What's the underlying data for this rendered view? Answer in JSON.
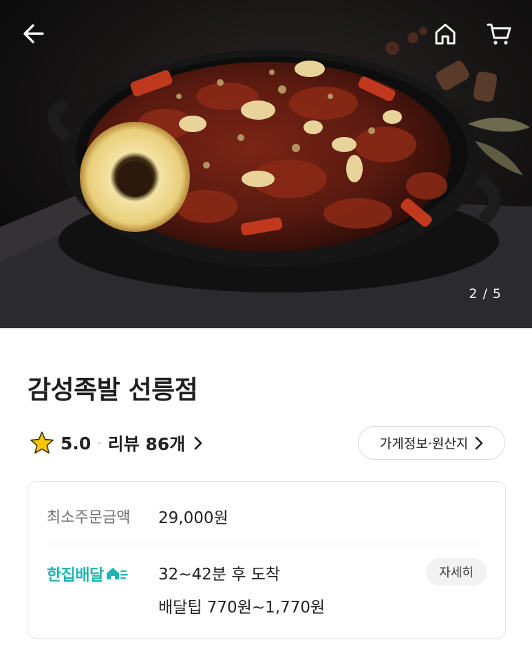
{
  "hero": {
    "image_counter": "2 / 5",
    "icons": {
      "back": "arrow-left-icon",
      "home": "home-icon",
      "cart": "cart-icon"
    }
  },
  "store": {
    "name": "감성족발 선릉점",
    "rating": "5.0",
    "separator": "·",
    "review_label": "리뷰 86개",
    "info_button": "가게정보·원산지"
  },
  "order_info": {
    "min_order_label": "최소주문금액",
    "min_order_value": "29,000원",
    "delivery_brand": "한집배달",
    "delivery_time": "32~42분 후 도착",
    "delivery_tip": "배달팁 770원~1,770원",
    "detail_button": "자세히"
  },
  "colors": {
    "brand_teal": "#1fb5b0",
    "star_yellow": "#f7c600",
    "text_primary": "#222222",
    "text_secondary": "#6f6f6f"
  }
}
